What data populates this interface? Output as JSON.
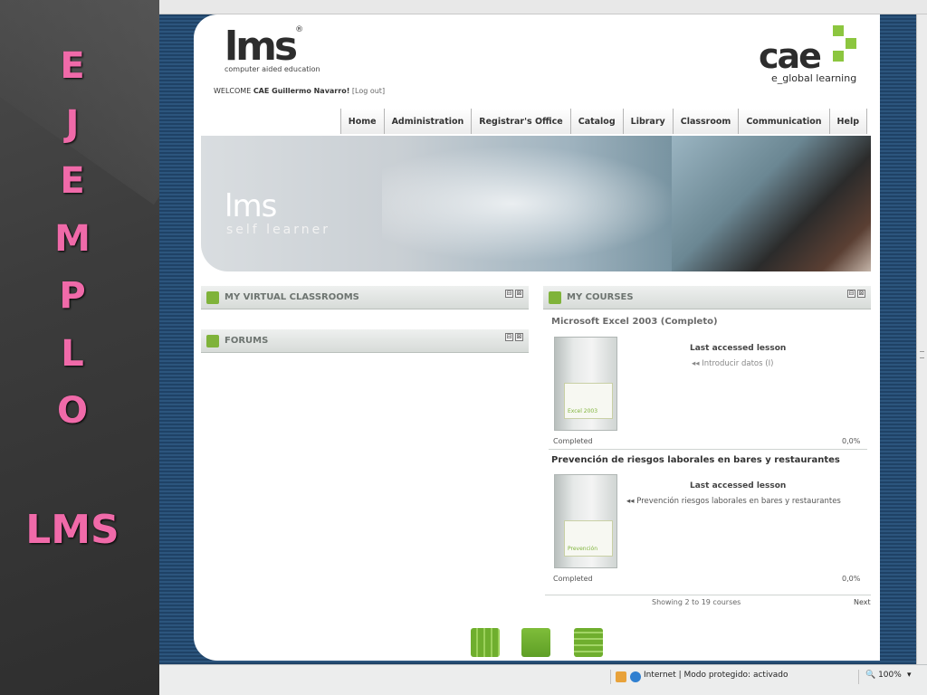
{
  "slide": {
    "letters": [
      "E",
      "J",
      "E",
      "M",
      "P",
      "L",
      "O"
    ],
    "word": "LMS"
  },
  "header": {
    "lms_logo": "lms",
    "lms_reg": "®",
    "lms_tagline": "computer aided education",
    "cae_logo": "cae",
    "cae_sub": "e_global learning",
    "welcome_prefix": "WELCOME",
    "welcome_name": "CAE Guillermo Navarro!",
    "logout": "[Log out]"
  },
  "nav": {
    "items": [
      "Home",
      "Administration",
      "Registrar's Office",
      "Catalog",
      "Library",
      "Classroom",
      "Communication",
      "Help"
    ]
  },
  "banner": {
    "title": "lms",
    "subtitle": "self learner"
  },
  "panels": {
    "virtual_classrooms": "MY VIRTUAL CLASSROOMS",
    "forums": "FORUMS",
    "my_courses": "MY COURSES",
    "ctrl_minimize": "⊟",
    "ctrl_close": "⊠"
  },
  "courses": [
    {
      "title": "Microsoft Excel 2003 (Completo)",
      "box_label": "Excel 2003",
      "last_label": "Last accessed lesson",
      "last_lesson": "◂◂ Introducir datos (I)",
      "status": "Completed",
      "progress": "0,0%"
    },
    {
      "title": "Prevención de riesgos laborales en bares y restaurantes",
      "box_label": "Prevención",
      "last_label": "Last accessed lesson",
      "last_lesson": "◂◂ Prevención riesgos laborales en bares y restaurantes",
      "status": "Completed",
      "progress": "0,0%"
    }
  ],
  "pager": {
    "showing": "Showing 2 to 19 courses",
    "next": "Next"
  },
  "statusbar": {
    "zone": "Internet | Modo protegido: activado",
    "zoom": "100%",
    "zoom_arrow": "▾"
  }
}
